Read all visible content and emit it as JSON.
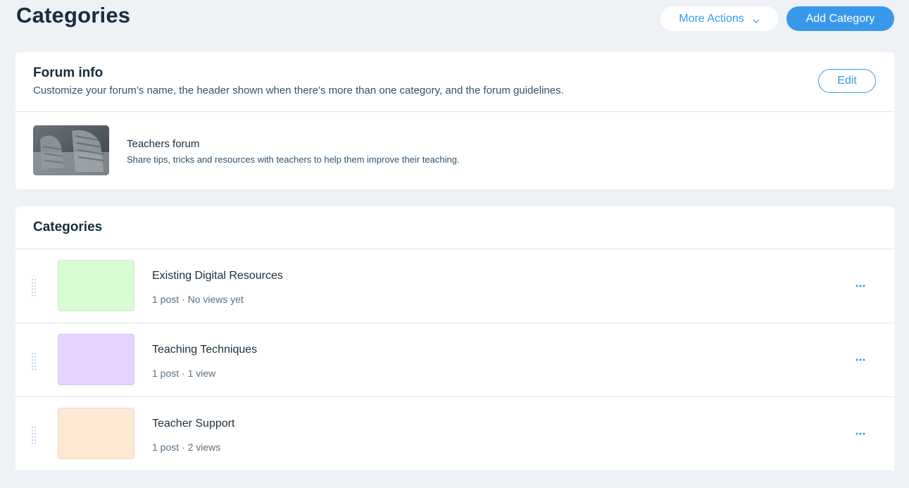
{
  "page": {
    "title": "Categories"
  },
  "header": {
    "more_actions_label": "More Actions",
    "add_category_label": "Add Category"
  },
  "forum_info": {
    "title": "Forum info",
    "description": "Customize your forum’s name, the header shown when there’s more than one category, and the forum guidelines.",
    "edit_label": "Edit",
    "forum_name": "Teachers forum",
    "forum_description": "Share tips, tricks and resources with teachers to help them improve their teaching."
  },
  "categories": {
    "title": "Categories",
    "items": [
      {
        "name": "Existing Digital Resources",
        "stats": "1 post · No views yet",
        "color": "#d7fcd3"
      },
      {
        "name": "Teaching Techniques",
        "stats": "1 post · 1 view",
        "color": "#e6d2fe"
      },
      {
        "name": "Teacher Support",
        "stats": "1 post · 2 views",
        "color": "#fde8d3"
      }
    ]
  },
  "colors": {
    "accent": "#3899ec",
    "background": "#eef1f5",
    "heading": "#162d3d"
  },
  "icons": {
    "more_actions": "chevron-down-icon",
    "drag": "drag-handle-icon",
    "row_menu": "more-horizontal-icon"
  }
}
